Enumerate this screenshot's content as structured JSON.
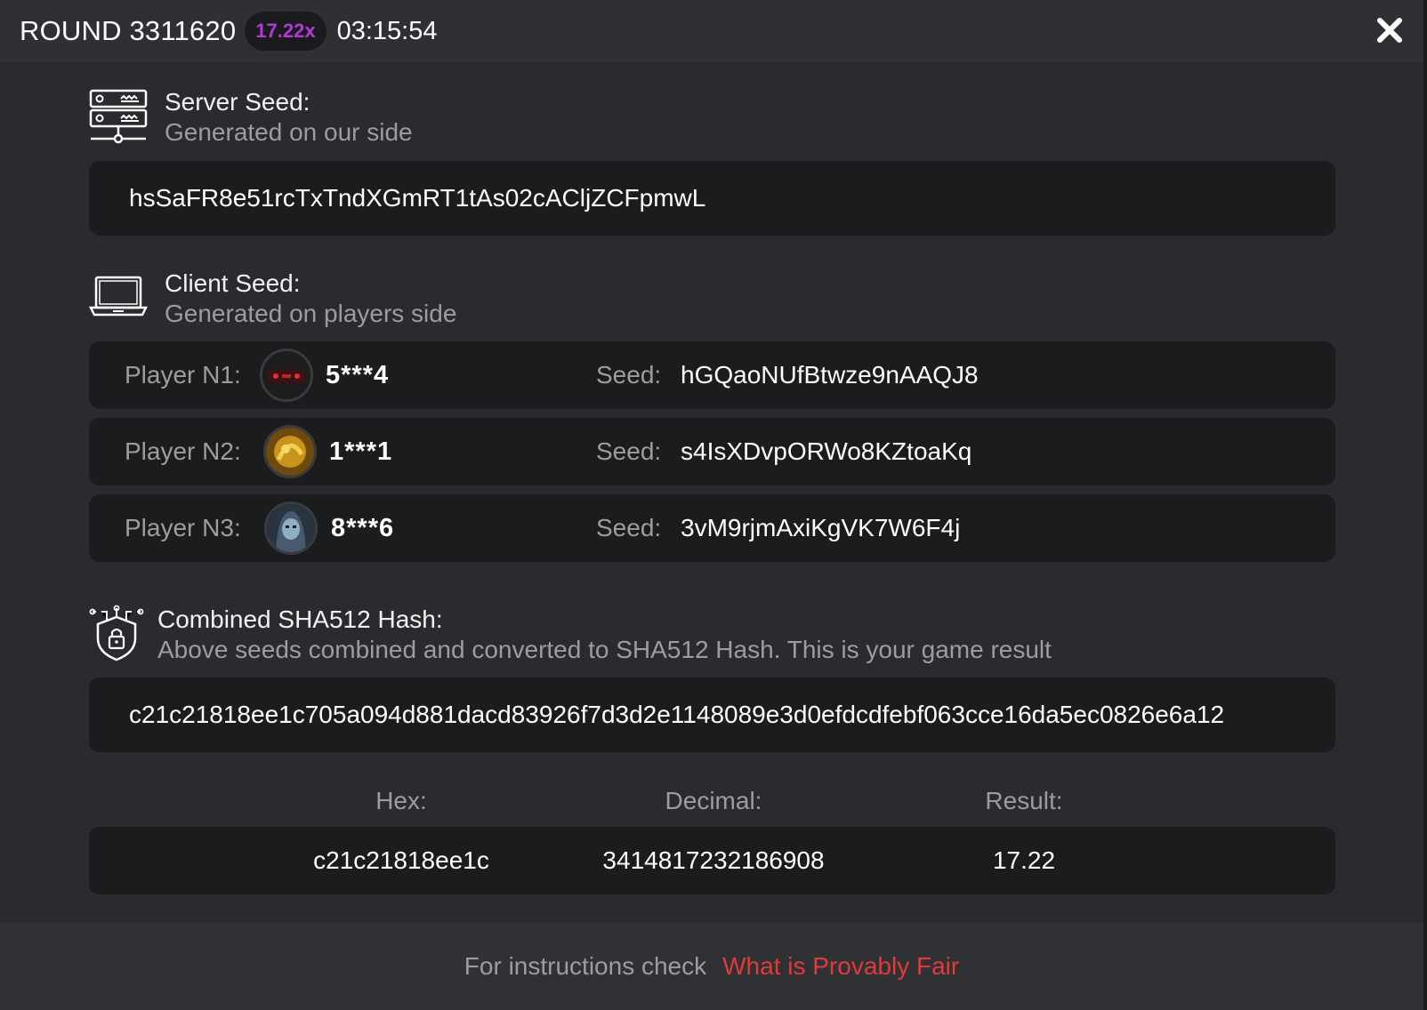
{
  "header": {
    "round_title": "ROUND 3311620",
    "multiplier": "17.22x",
    "time": "03:15:54",
    "close_icon": "close-icon"
  },
  "server_seed": {
    "icon": "server-icon",
    "title": "Server Seed:",
    "subtitle": "Generated on our side",
    "value": "hsSaFR8e51rcTxTndXGmRT1tAs02cACljZCFpmwL"
  },
  "client_seed": {
    "icon": "laptop-icon",
    "title": "Client Seed:",
    "subtitle": "Generated on players side",
    "players": [
      {
        "label": "Player N1:",
        "name": "5***4",
        "seed_label": "Seed:",
        "seed": "hGQaoNUfBtwze9nAAQJ8",
        "avatar_color": "#3a1414"
      },
      {
        "label": "Player N2:",
        "name": "1***1",
        "seed_label": "Seed:",
        "seed": "s4IsXDvpORWo8KZtoaKq",
        "avatar_color": "#c8941c"
      },
      {
        "label": "Player N3:",
        "name": "8***6",
        "seed_label": "Seed:",
        "seed": "3vM9rjmAxiKgVK7W6F4j",
        "avatar_color": "#4a5a6e"
      }
    ]
  },
  "hash": {
    "icon": "shield-lock-icon",
    "title": "Combined SHA512 Hash:",
    "subtitle": "Above seeds combined and converted to SHA512 Hash. This is your game result",
    "value": "c21c21818ee1c705a094d881dacd83926f7d3d2e1148089e3d0efdcdfebf063cce16da5ec0826e6a12"
  },
  "result": {
    "hex_label": "Hex:",
    "decimal_label": "Decimal:",
    "result_label": "Result:",
    "hex": "c21c21818ee1c",
    "decimal": "3414817232186908",
    "result": "17.22"
  },
  "footer": {
    "text": "For instructions check",
    "link": "What is Provably Fair"
  },
  "colors": {
    "accent_multiplier": "#b13ad6",
    "link": "#e23a3a"
  }
}
